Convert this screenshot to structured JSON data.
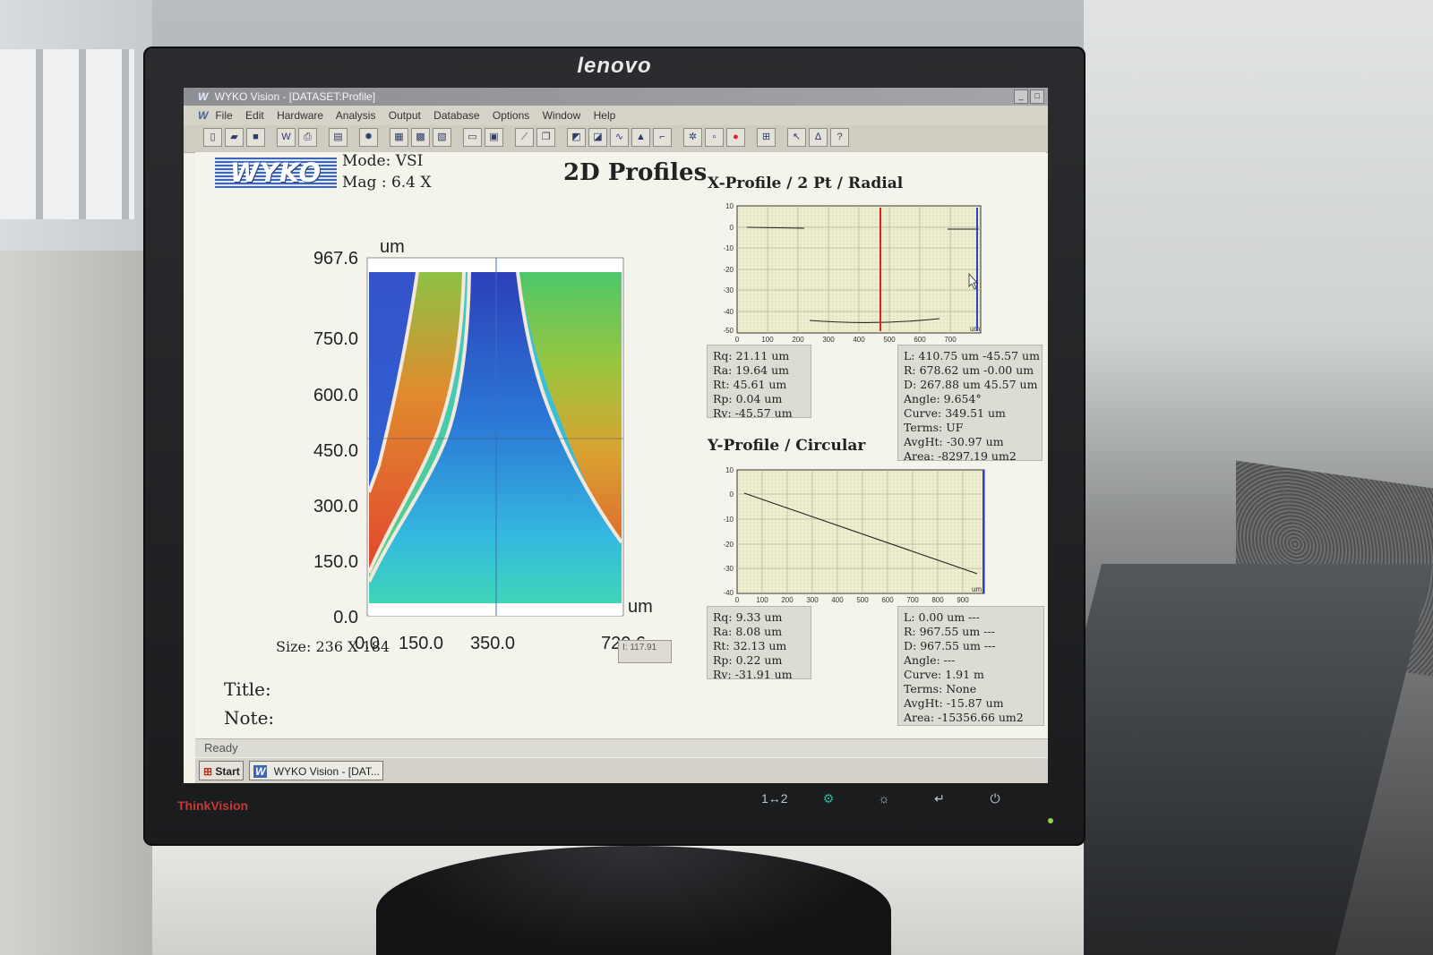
{
  "monitor": {
    "brand": "lenovo",
    "model_label": "ThinkVision",
    "controls": [
      "1↔2",
      "⚙",
      "☼",
      "↵",
      "⏻"
    ]
  },
  "window": {
    "logo": "W",
    "title": "WYKO Vision - [DATASET:Profile]",
    "buttons": [
      "_",
      "□"
    ]
  },
  "menu": {
    "items": [
      "File",
      "Edit",
      "Hardware",
      "Analysis",
      "Output",
      "Database",
      "Options",
      "Window",
      "Help"
    ]
  },
  "toolbar": {
    "groups": [
      [
        "new-icon",
        "open-icon",
        "save-icon"
      ],
      [
        "wyko-icon",
        "print-icon"
      ],
      [
        "page-icon"
      ],
      [
        "sun-icon"
      ],
      [
        "map-icon",
        "grid-icon",
        "color-icon"
      ],
      [
        "view-icon",
        "window-icon"
      ],
      [
        "ruler-icon",
        "copy-icon"
      ],
      [
        "surface-icon",
        "slope-icon",
        "wave-icon",
        "peak-icon",
        "step-icon"
      ],
      [
        "gear-icon",
        "stop-icon",
        "record-icon"
      ],
      [
        "filter-icon"
      ],
      [
        "pointer-icon",
        "stat-icon",
        "help-icon"
      ]
    ],
    "glyphs": {
      "new-icon": "▯",
      "open-icon": "▰",
      "save-icon": "■",
      "wyko-icon": "W",
      "print-icon": "⎙",
      "page-icon": "▤",
      "sun-icon": "✹",
      "map-icon": "▦",
      "grid-icon": "▩",
      "color-icon": "▧",
      "view-icon": "▭",
      "window-icon": "▣",
      "ruler-icon": "⟋",
      "copy-icon": "❐",
      "surface-icon": "◩",
      "slope-icon": "◪",
      "wave-icon": "∿",
      "peak-icon": "▲",
      "step-icon": "⌐",
      "gear-icon": "✲",
      "stop-icon": "▫",
      "record-icon": "●",
      "filter-icon": "⊞",
      "pointer-icon": "↖",
      "stat-icon": "∆",
      "help-icon": "?"
    },
    "record_color": "#e02020"
  },
  "header": {
    "logo_text": "WYKO",
    "mode": "Mode: VSI",
    "mag": "Mag : 6.4 X",
    "title": "2D Profiles"
  },
  "map": {
    "unit": "um",
    "y_ticks": [
      "967.6",
      "750.0",
      "600.0",
      "450.0",
      "300.0",
      "150.0",
      "0.0"
    ],
    "x_ticks": [
      "0.0",
      "150.0",
      "350.0",
      "720.6"
    ],
    "size": "Size: 236 X 184",
    "readout": "I: 117.91"
  },
  "x_profile": {
    "title": "X-Profile / 2 Pt / Radial",
    "y_ticks": [
      "10",
      "0",
      "-10",
      "-20",
      "-30",
      "-40",
      "-50"
    ],
    "x_ticks": [
      "0",
      "100",
      "200",
      "300",
      "400",
      "500",
      "600",
      "700"
    ],
    "unit": "um",
    "cursor_colors": [
      "#e02424",
      "#2c43c8"
    ],
    "stats_left": [
      "Rq:  21.11 um",
      "Ra:  19.64 um",
      "Rt:  45.61 um",
      "Rp:  0.04 um",
      "Rv:  -45.57 um"
    ],
    "stats_right": [
      "L:  410.75 um  -45.57 um",
      "R:  678.62 um  -0.00 um",
      "D:  267.88 um  45.57 um",
      "Angle:  9.654°",
      "Curve:  349.51 um",
      "Terms:  UF",
      "AvgHt:  -30.97 um",
      "Area:  -8297.19 um2"
    ]
  },
  "y_profile": {
    "title": "Y-Profile / Circular",
    "y_ticks": [
      "10",
      "0",
      "-10",
      "-20",
      "-30",
      "-40"
    ],
    "x_ticks": [
      "0",
      "100",
      "200",
      "300",
      "400",
      "500",
      "600",
      "700",
      "800",
      "900"
    ],
    "unit": "um",
    "stats_left": [
      "Rq:  9.33 um",
      "Ra:  8.08 um",
      "Rt:  32.13 um",
      "Rp:  0.22 um",
      "Rv:  -31.91 um"
    ],
    "stats_right": [
      "L:  0.00 um  ---",
      "R:  967.55 um  ---",
      "D:  967.55 um  ---",
      "Angle:  ---",
      "Curve:  1.91 m",
      "Terms:  None",
      "AvgHt:  -15.87 um",
      "Area:  -15356.66 um2"
    ]
  },
  "labels": {
    "title": "Title:",
    "note": "Note:"
  },
  "status": {
    "text": "Ready"
  },
  "taskbar": {
    "start": "Start",
    "task": "WYKO Vision - [DAT..."
  }
}
